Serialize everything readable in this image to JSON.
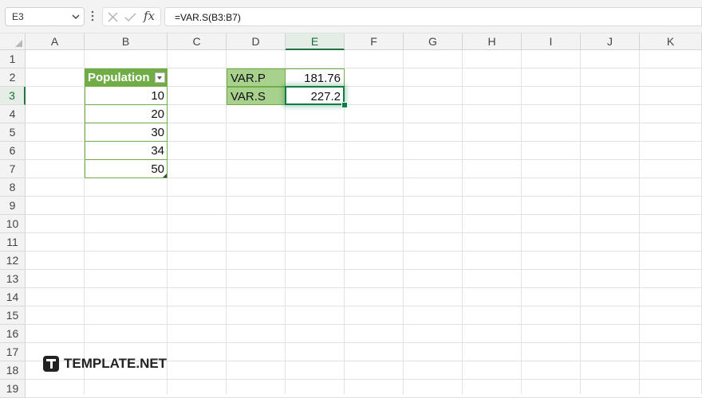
{
  "namebox": {
    "value": "E3"
  },
  "formula_bar": {
    "fx_label": "fx",
    "formula": "=VAR.S(B3:B7)"
  },
  "columns": [
    "A",
    "B",
    "C",
    "D",
    "E",
    "F",
    "G",
    "H",
    "I",
    "J",
    "K"
  ],
  "rows": [
    "1",
    "2",
    "3",
    "4",
    "5",
    "6",
    "7",
    "8",
    "9",
    "10",
    "11",
    "12",
    "13",
    "14",
    "15",
    "16",
    "17",
    "18",
    "19"
  ],
  "selected_cell": "E3",
  "table": {
    "header": "Population",
    "values": [
      "10",
      "20",
      "30",
      "34",
      "50"
    ]
  },
  "stats": {
    "varp_label": "VAR.P",
    "varp_value": "181.76",
    "vars_label": "VAR.S",
    "vars_value": "227.2"
  },
  "watermark": {
    "text": "TEMPLATE.NET"
  },
  "colors": {
    "accent": "#107c41",
    "table_header": "#70ad47",
    "label_fill": "#a9d18e"
  }
}
